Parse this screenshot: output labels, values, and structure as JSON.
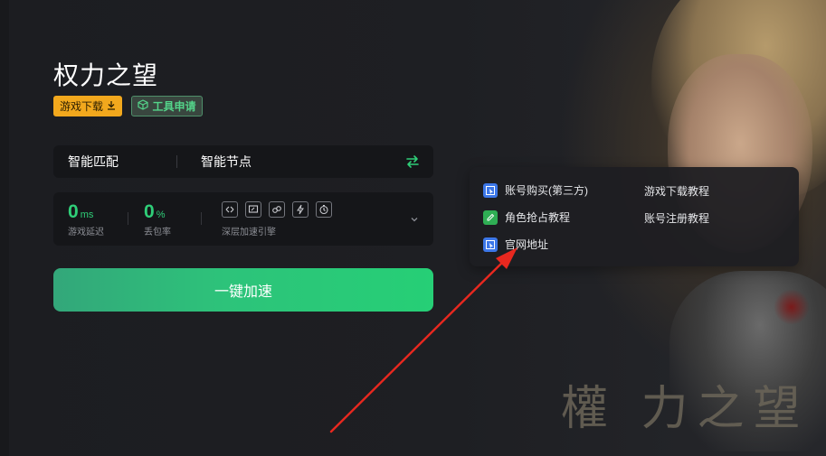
{
  "colors": {
    "accent_green": "#2fce78",
    "download_orange": "#f2a81d",
    "popup_blue": "#3c77e8",
    "popup_green": "#2fae54",
    "arrow_red": "#e8281f"
  },
  "header": {
    "title": "权力之望",
    "download_label": "游戏下载",
    "download_icon": "download-icon",
    "tool_label": "工具申请",
    "tool_icon": "cube-icon"
  },
  "mode_bar": {
    "mode": "智能匹配",
    "node": "智能节点",
    "swap_icon": "swap-icon"
  },
  "stats": {
    "latency_value": "0",
    "latency_unit": "ms",
    "latency_label": "游戏延迟",
    "loss_value": "0",
    "loss_unit": "%",
    "loss_label": "丢包率",
    "engine_label": "深层加速引擎",
    "engine_icons": [
      "link-icon",
      "screen-icon",
      "nodes-icon",
      "bolt-icon",
      "timer-icon"
    ],
    "expand_icon": "chevron-down-icon"
  },
  "accelerate": {
    "label": "一键加速"
  },
  "popup": {
    "items": [
      {
        "label": "账号购买(第三方)",
        "icon": "cursor-icon"
      },
      {
        "label": "角色抢占教程",
        "icon": "pencil-icon"
      },
      {
        "label": "官网地址",
        "icon": "cursor-icon"
      }
    ],
    "links": [
      {
        "label": "游戏下载教程"
      },
      {
        "label": "账号注册教程"
      }
    ]
  },
  "background": {
    "art_title": "權 力之望"
  }
}
